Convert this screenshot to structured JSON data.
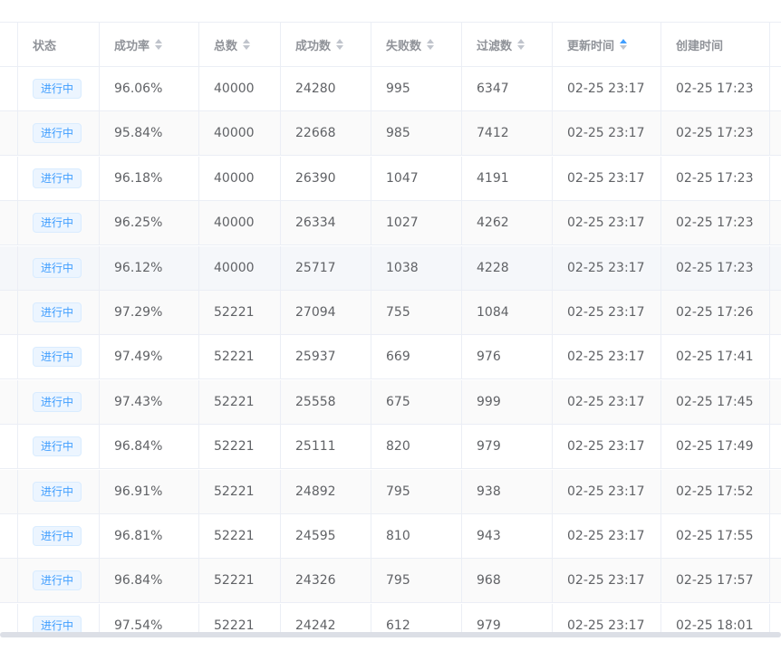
{
  "columns": [
    {
      "label": "状态",
      "sortable": false
    },
    {
      "label": "成功率",
      "sortable": true
    },
    {
      "label": "总数",
      "sortable": true
    },
    {
      "label": "成功数",
      "sortable": true
    },
    {
      "label": "失败数",
      "sortable": true
    },
    {
      "label": "过滤数",
      "sortable": true
    },
    {
      "label": "更新时间",
      "sortable": true,
      "sort_active": "ascending"
    },
    {
      "label": "创建时间",
      "sortable": false
    }
  ],
  "rows": [
    {
      "status": "进行中",
      "rate": "96.06%",
      "total": "40000",
      "success": "24280",
      "fail": "995",
      "filtered": "6347",
      "updated": "02-25 23:17",
      "created": "02-25 17:23"
    },
    {
      "status": "进行中",
      "rate": "95.84%",
      "total": "40000",
      "success": "22668",
      "fail": "985",
      "filtered": "7412",
      "updated": "02-25 23:17",
      "created": "02-25 17:23"
    },
    {
      "status": "进行中",
      "rate": "96.18%",
      "total": "40000",
      "success": "26390",
      "fail": "1047",
      "filtered": "4191",
      "updated": "02-25 23:17",
      "created": "02-25 17:23"
    },
    {
      "status": "进行中",
      "rate": "96.25%",
      "total": "40000",
      "success": "26334",
      "fail": "1027",
      "filtered": "4262",
      "updated": "02-25 23:17",
      "created": "02-25 17:23"
    },
    {
      "status": "进行中",
      "rate": "96.12%",
      "total": "40000",
      "success": "25717",
      "fail": "1038",
      "filtered": "4228",
      "updated": "02-25 23:17",
      "created": "02-25 17:23"
    },
    {
      "status": "进行中",
      "rate": "97.29%",
      "total": "52221",
      "success": "27094",
      "fail": "755",
      "filtered": "1084",
      "updated": "02-25 23:17",
      "created": "02-25 17:26"
    },
    {
      "status": "进行中",
      "rate": "97.49%",
      "total": "52221",
      "success": "25937",
      "fail": "669",
      "filtered": "976",
      "updated": "02-25 23:17",
      "created": "02-25 17:41"
    },
    {
      "status": "进行中",
      "rate": "97.43%",
      "total": "52221",
      "success": "25558",
      "fail": "675",
      "filtered": "999",
      "updated": "02-25 23:17",
      "created": "02-25 17:45"
    },
    {
      "status": "进行中",
      "rate": "96.84%",
      "total": "52221",
      "success": "25111",
      "fail": "820",
      "filtered": "979",
      "updated": "02-25 23:17",
      "created": "02-25 17:49"
    },
    {
      "status": "进行中",
      "rate": "96.91%",
      "total": "52221",
      "success": "24892",
      "fail": "795",
      "filtered": "938",
      "updated": "02-25 23:17",
      "created": "02-25 17:52"
    },
    {
      "status": "进行中",
      "rate": "96.81%",
      "total": "52221",
      "success": "24595",
      "fail": "810",
      "filtered": "943",
      "updated": "02-25 23:17",
      "created": "02-25 17:55"
    },
    {
      "status": "进行中",
      "rate": "96.84%",
      "total": "52221",
      "success": "24326",
      "fail": "795",
      "filtered": "968",
      "updated": "02-25 23:17",
      "created": "02-25 17:57"
    },
    {
      "status": "进行中",
      "rate": "97.54%",
      "total": "52221",
      "success": "24242",
      "fail": "612",
      "filtered": "979",
      "updated": "02-25 23:17",
      "created": "02-25 18:01"
    }
  ],
  "colors": {
    "tag_text": "#409eff",
    "tag_bg": "#ecf5ff",
    "sort_active": "#409eff",
    "sort_idle": "#c0c4cc"
  }
}
